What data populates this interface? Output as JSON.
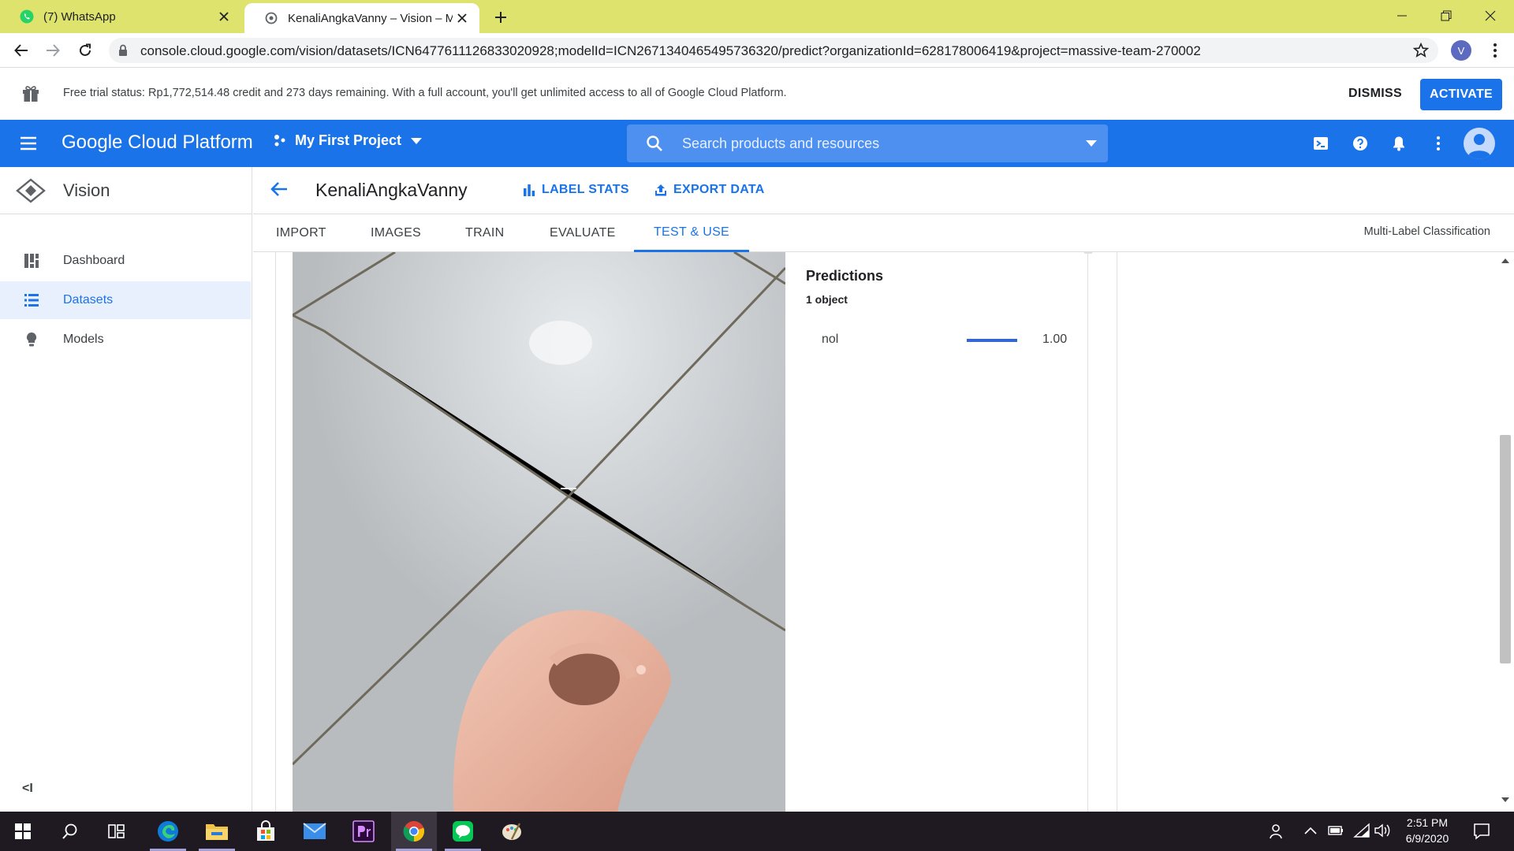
{
  "browser": {
    "tabs": [
      {
        "title": "(7) WhatsApp",
        "active": false
      },
      {
        "title": "KenaliAngkaVanny – Vision – My",
        "active": true
      }
    ],
    "url": "console.cloud.google.com/vision/datasets/ICN6477611126833020928;modelId=ICN2671340465495736320/predict?organizationId=628178006419&project=massive-team-270002",
    "profile_initial": "V"
  },
  "trial_banner": {
    "text": "Free trial status: Rp1,772,514.48 credit and 273 days remaining. With a full account, you'll get unlimited access to all of Google Cloud Platform.",
    "dismiss_label": "DISMISS",
    "activate_label": "ACTIVATE"
  },
  "header": {
    "brand": "Google Cloud Platform",
    "project": "My First Project",
    "search_placeholder": "Search products and resources",
    "accent_color": "#1a73e8"
  },
  "sidebar": {
    "product": "Vision",
    "items": [
      {
        "label": "Dashboard",
        "icon": "dashboard-icon",
        "selected": false
      },
      {
        "label": "Datasets",
        "icon": "list-icon",
        "selected": true
      },
      {
        "label": "Models",
        "icon": "lightbulb-icon",
        "selected": false
      }
    ],
    "collapse_label": "<I"
  },
  "content": {
    "dataset_name": "KenaliAngkaVanny",
    "actions": {
      "label_stats": "LABEL STATS",
      "export_data": "EXPORT DATA"
    },
    "tabs": [
      "IMPORT",
      "IMAGES",
      "TRAIN",
      "EVALUATE",
      "TEST & USE"
    ],
    "active_tab": "TEST & USE",
    "model_type": "Multi-Label Classification"
  },
  "predictions": {
    "title": "Predictions",
    "count_text": "1 object",
    "items": [
      {
        "label": "nol",
        "score": "1.00",
        "fraction": 1.0
      }
    ]
  },
  "taskbar": {
    "apps": [
      "start-icon",
      "search-icon",
      "task-view-icon",
      "edge-icon",
      "file-explorer-icon",
      "store-icon",
      "mail-icon",
      "premiere-icon",
      "chrome-icon",
      "line-icon",
      "paint-icon"
    ],
    "time": "2:51 PM",
    "date": "6/9/2020"
  }
}
